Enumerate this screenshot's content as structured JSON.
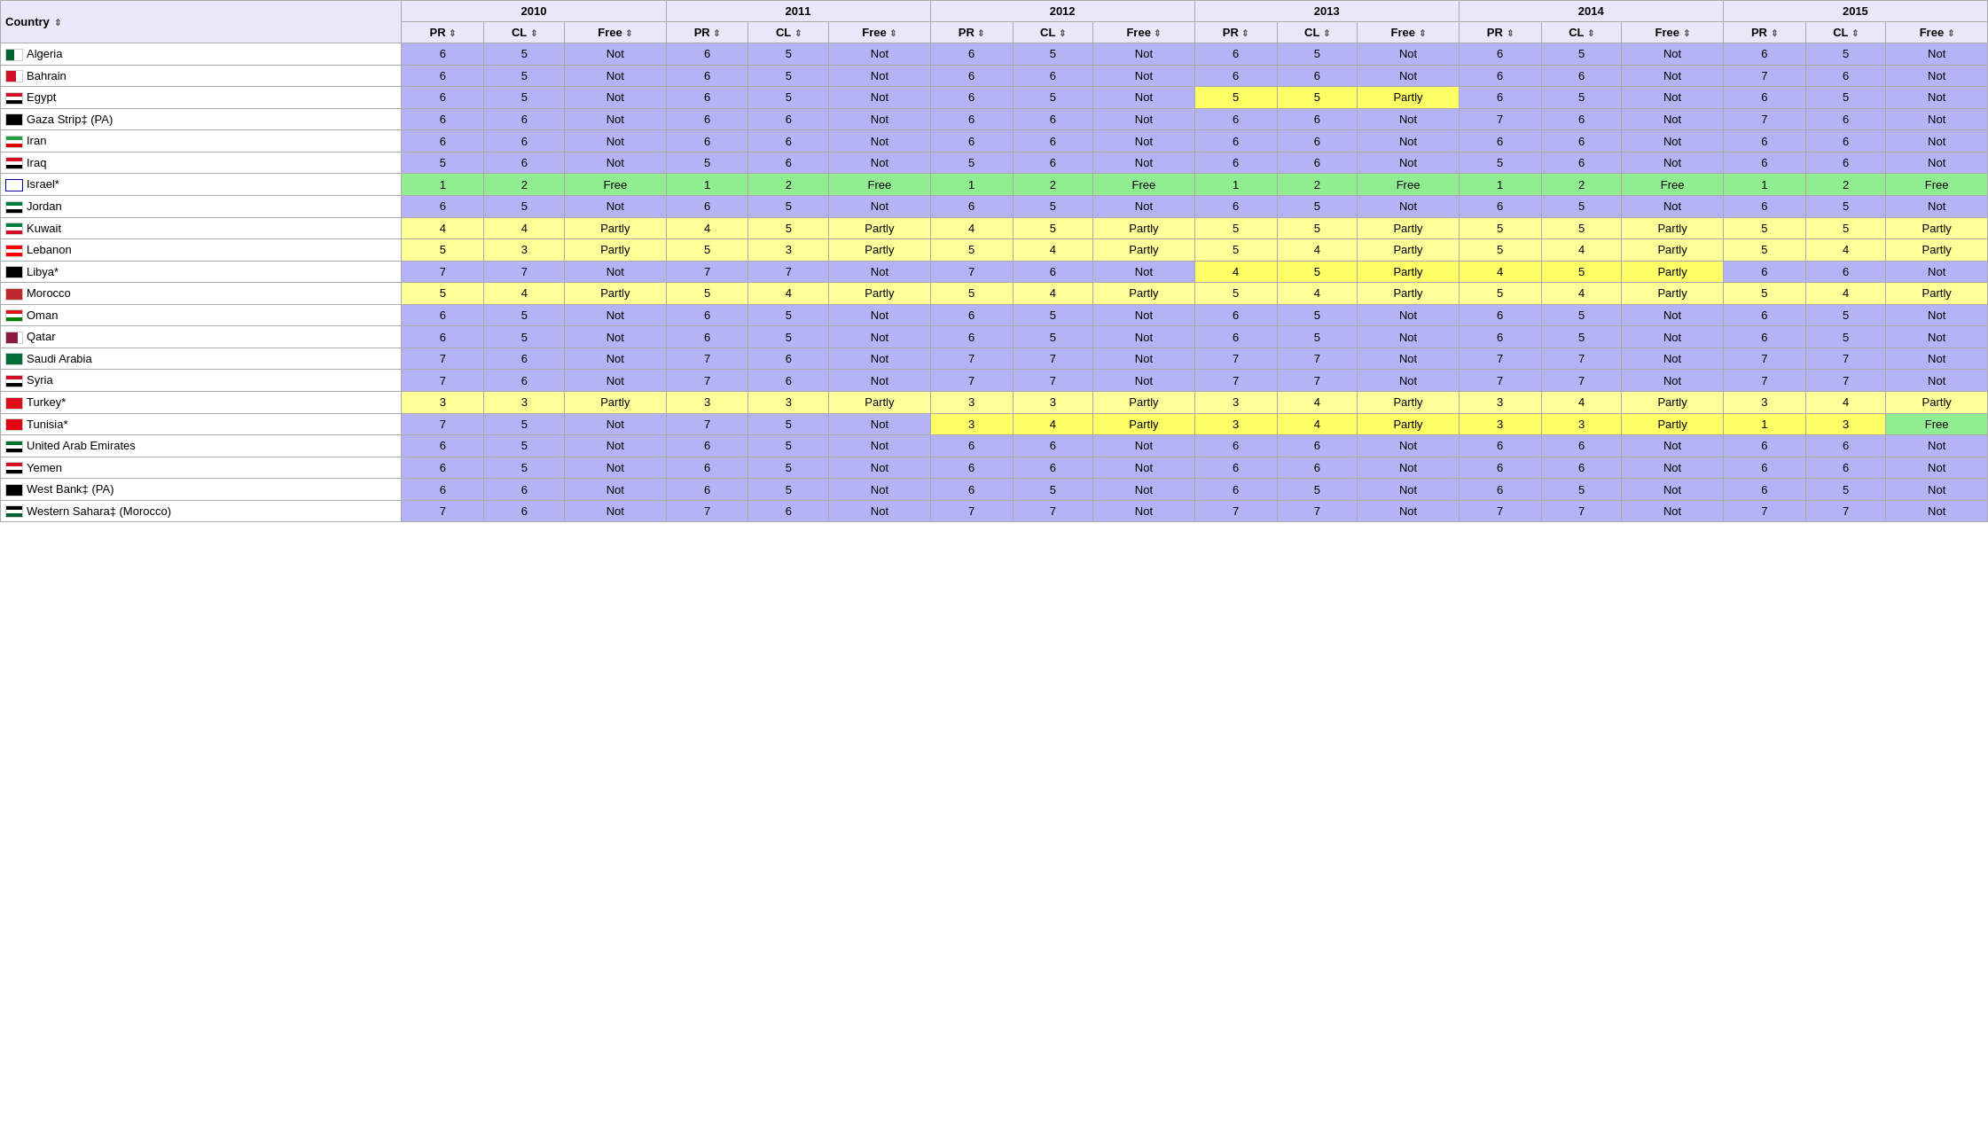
{
  "table": {
    "years": [
      "2010",
      "2011",
      "2012",
      "2013",
      "2014",
      "2015"
    ],
    "col_country": "Country",
    "sub_cols": [
      "PR",
      "CL",
      "Free"
    ],
    "countries": [
      {
        "name": "Algeria",
        "flag": "dz",
        "data": [
          [
            6,
            5,
            "Not"
          ],
          [
            6,
            5,
            "Not"
          ],
          [
            6,
            5,
            "Not"
          ],
          [
            6,
            5,
            "Not"
          ],
          [
            6,
            5,
            "Not"
          ],
          [
            6,
            5,
            "Not"
          ]
        ]
      },
      {
        "name": "Bahrain",
        "flag": "bh",
        "data": [
          [
            6,
            5,
            "Not"
          ],
          [
            6,
            5,
            "Not"
          ],
          [
            6,
            6,
            "Not"
          ],
          [
            6,
            6,
            "Not"
          ],
          [
            6,
            6,
            "Not"
          ],
          [
            7,
            6,
            "Not"
          ]
        ]
      },
      {
        "name": "Egypt",
        "flag": "eg",
        "data": [
          [
            6,
            5,
            "Not"
          ],
          [
            6,
            5,
            "Not"
          ],
          [
            6,
            5,
            "Not"
          ],
          [
            5,
            5,
            "Partly"
          ],
          [
            6,
            5,
            "Not"
          ],
          [
            6,
            5,
            "Not"
          ]
        ],
        "highlights": [
          3
        ]
      },
      {
        "name": "Gaza Strip‡ (PA)",
        "flag": "ps-g",
        "data": [
          [
            6,
            6,
            "Not"
          ],
          [
            6,
            6,
            "Not"
          ],
          [
            6,
            6,
            "Not"
          ],
          [
            6,
            6,
            "Not"
          ],
          [
            7,
            6,
            "Not"
          ],
          [
            7,
            6,
            "Not"
          ]
        ]
      },
      {
        "name": "Iran",
        "flag": "ir",
        "data": [
          [
            6,
            6,
            "Not"
          ],
          [
            6,
            6,
            "Not"
          ],
          [
            6,
            6,
            "Not"
          ],
          [
            6,
            6,
            "Not"
          ],
          [
            6,
            6,
            "Not"
          ],
          [
            6,
            6,
            "Not"
          ]
        ]
      },
      {
        "name": "Iraq",
        "flag": "iq",
        "data": [
          [
            5,
            6,
            "Not"
          ],
          [
            5,
            6,
            "Not"
          ],
          [
            5,
            6,
            "Not"
          ],
          [
            6,
            6,
            "Not"
          ],
          [
            5,
            6,
            "Not"
          ],
          [
            6,
            6,
            "Not"
          ]
        ]
      },
      {
        "name": "Israel*",
        "flag": "il",
        "data": [
          [
            1,
            2,
            "Free"
          ],
          [
            1,
            2,
            "Free"
          ],
          [
            1,
            2,
            "Free"
          ],
          [
            1,
            2,
            "Free"
          ],
          [
            1,
            2,
            "Free"
          ],
          [
            1,
            2,
            "Free"
          ]
        ]
      },
      {
        "name": "Jordan",
        "flag": "jo",
        "data": [
          [
            6,
            5,
            "Not"
          ],
          [
            6,
            5,
            "Not"
          ],
          [
            6,
            5,
            "Not"
          ],
          [
            6,
            5,
            "Not"
          ],
          [
            6,
            5,
            "Not"
          ],
          [
            6,
            5,
            "Not"
          ]
        ]
      },
      {
        "name": "Kuwait",
        "flag": "kw",
        "data": [
          [
            4,
            4,
            "Partly"
          ],
          [
            4,
            5,
            "Partly"
          ],
          [
            4,
            5,
            "Partly"
          ],
          [
            5,
            5,
            "Partly"
          ],
          [
            5,
            5,
            "Partly"
          ],
          [
            5,
            5,
            "Partly"
          ]
        ]
      },
      {
        "name": "Lebanon",
        "flag": "lb",
        "data": [
          [
            5,
            3,
            "Partly"
          ],
          [
            5,
            3,
            "Partly"
          ],
          [
            5,
            4,
            "Partly"
          ],
          [
            5,
            4,
            "Partly"
          ],
          [
            5,
            4,
            "Partly"
          ],
          [
            5,
            4,
            "Partly"
          ]
        ]
      },
      {
        "name": "Libya*",
        "flag": "ly",
        "data": [
          [
            7,
            7,
            "Not"
          ],
          [
            7,
            7,
            "Not"
          ],
          [
            7,
            6,
            "Not"
          ],
          [
            4,
            5,
            "Partly"
          ],
          [
            4,
            5,
            "Partly"
          ],
          [
            6,
            6,
            "Not"
          ]
        ],
        "highlights": [
          3,
          4
        ]
      },
      {
        "name": "Morocco",
        "flag": "ma",
        "data": [
          [
            5,
            4,
            "Partly"
          ],
          [
            5,
            4,
            "Partly"
          ],
          [
            5,
            4,
            "Partly"
          ],
          [
            5,
            4,
            "Partly"
          ],
          [
            5,
            4,
            "Partly"
          ],
          [
            5,
            4,
            "Partly"
          ]
        ]
      },
      {
        "name": "Oman",
        "flag": "om",
        "data": [
          [
            6,
            5,
            "Not"
          ],
          [
            6,
            5,
            "Not"
          ],
          [
            6,
            5,
            "Not"
          ],
          [
            6,
            5,
            "Not"
          ],
          [
            6,
            5,
            "Not"
          ],
          [
            6,
            5,
            "Not"
          ]
        ]
      },
      {
        "name": "Qatar",
        "flag": "qa",
        "data": [
          [
            6,
            5,
            "Not"
          ],
          [
            6,
            5,
            "Not"
          ],
          [
            6,
            5,
            "Not"
          ],
          [
            6,
            5,
            "Not"
          ],
          [
            6,
            5,
            "Not"
          ],
          [
            6,
            5,
            "Not"
          ]
        ]
      },
      {
        "name": "Saudi Arabia",
        "flag": "sa",
        "data": [
          [
            7,
            6,
            "Not"
          ],
          [
            7,
            6,
            "Not"
          ],
          [
            7,
            7,
            "Not"
          ],
          [
            7,
            7,
            "Not"
          ],
          [
            7,
            7,
            "Not"
          ],
          [
            7,
            7,
            "Not"
          ]
        ]
      },
      {
        "name": "Syria",
        "flag": "sy",
        "data": [
          [
            7,
            6,
            "Not"
          ],
          [
            7,
            6,
            "Not"
          ],
          [
            7,
            7,
            "Not"
          ],
          [
            7,
            7,
            "Not"
          ],
          [
            7,
            7,
            "Not"
          ],
          [
            7,
            7,
            "Not"
          ]
        ]
      },
      {
        "name": "Turkey*",
        "flag": "tr",
        "data": [
          [
            3,
            3,
            "Partly"
          ],
          [
            3,
            3,
            "Partly"
          ],
          [
            3,
            3,
            "Partly"
          ],
          [
            3,
            4,
            "Partly"
          ],
          [
            3,
            4,
            "Partly"
          ],
          [
            3,
            4,
            "Partly"
          ]
        ]
      },
      {
        "name": "Tunisia*",
        "flag": "tn",
        "data": [
          [
            7,
            5,
            "Not"
          ],
          [
            7,
            5,
            "Not"
          ],
          [
            3,
            4,
            "Partly"
          ],
          [
            3,
            4,
            "Partly"
          ],
          [
            3,
            3,
            "Partly"
          ],
          [
            1,
            3,
            "Free"
          ]
        ],
        "highlights": [
          2,
          3,
          4,
          5
        ]
      },
      {
        "name": "United Arab Emirates",
        "flag": "ae",
        "data": [
          [
            6,
            5,
            "Not"
          ],
          [
            6,
            5,
            "Not"
          ],
          [
            6,
            6,
            "Not"
          ],
          [
            6,
            6,
            "Not"
          ],
          [
            6,
            6,
            "Not"
          ],
          [
            6,
            6,
            "Not"
          ]
        ]
      },
      {
        "name": "Yemen",
        "flag": "ye",
        "data": [
          [
            6,
            5,
            "Not"
          ],
          [
            6,
            5,
            "Not"
          ],
          [
            6,
            6,
            "Not"
          ],
          [
            6,
            6,
            "Not"
          ],
          [
            6,
            6,
            "Not"
          ],
          [
            6,
            6,
            "Not"
          ]
        ]
      },
      {
        "name": "West Bank‡ (PA)",
        "flag": "ps-wb",
        "data": [
          [
            6,
            6,
            "Not"
          ],
          [
            6,
            5,
            "Not"
          ],
          [
            6,
            5,
            "Not"
          ],
          [
            6,
            5,
            "Not"
          ],
          [
            6,
            5,
            "Not"
          ],
          [
            6,
            5,
            "Not"
          ]
        ]
      },
      {
        "name": "Western Sahara‡ (Morocco)",
        "flag": "eh",
        "data": [
          [
            7,
            6,
            "Not"
          ],
          [
            7,
            6,
            "Not"
          ],
          [
            7,
            7,
            "Not"
          ],
          [
            7,
            7,
            "Not"
          ],
          [
            7,
            7,
            "Not"
          ],
          [
            7,
            7,
            "Not"
          ]
        ]
      }
    ]
  }
}
